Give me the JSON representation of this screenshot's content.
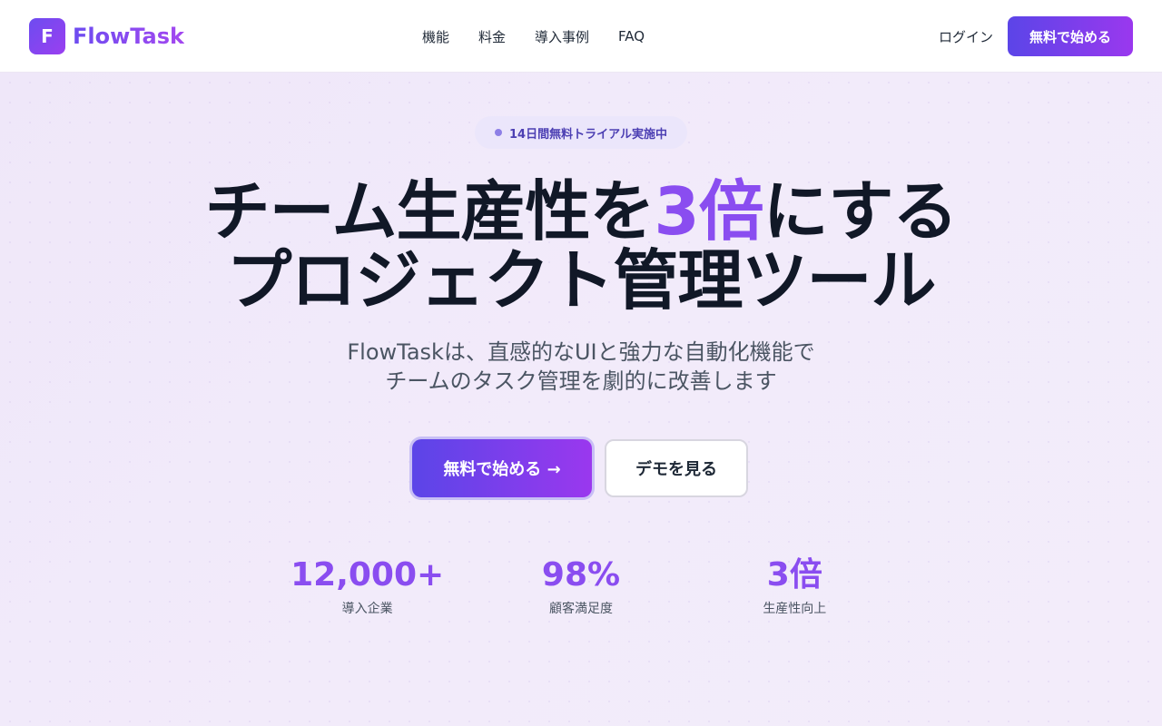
{
  "brand": {
    "logo_letter": "F",
    "name": "FlowTask"
  },
  "nav": {
    "items": [
      "機能",
      "料金",
      "導入事例",
      "FAQ"
    ]
  },
  "header": {
    "login": "ログイン",
    "cta": "無料で始める"
  },
  "hero": {
    "badge": "14日間無料トライアル実施中",
    "headline_line1_before": "チーム生産性を",
    "headline_accent": "3倍",
    "headline_line1_after": "にする",
    "headline_line2": "プロジェクト管理ツール",
    "sub_line1": "FlowTaskは、直感的なUIと強力な自動化機能で",
    "sub_line2": "チームのタスク管理を劇的に改善します",
    "cta_primary": "無料で始める →",
    "cta_secondary": "デモを見る"
  },
  "stats": [
    {
      "value": "12,000+",
      "label": "導入企業"
    },
    {
      "value": "98%",
      "label": "顧客満足度"
    },
    {
      "value": "3倍",
      "label": "生産性向上"
    }
  ],
  "colors": {
    "accent": "#8a4df0",
    "brand_gradient_start": "#5b45e8",
    "brand_gradient_end": "#9a38ee"
  }
}
